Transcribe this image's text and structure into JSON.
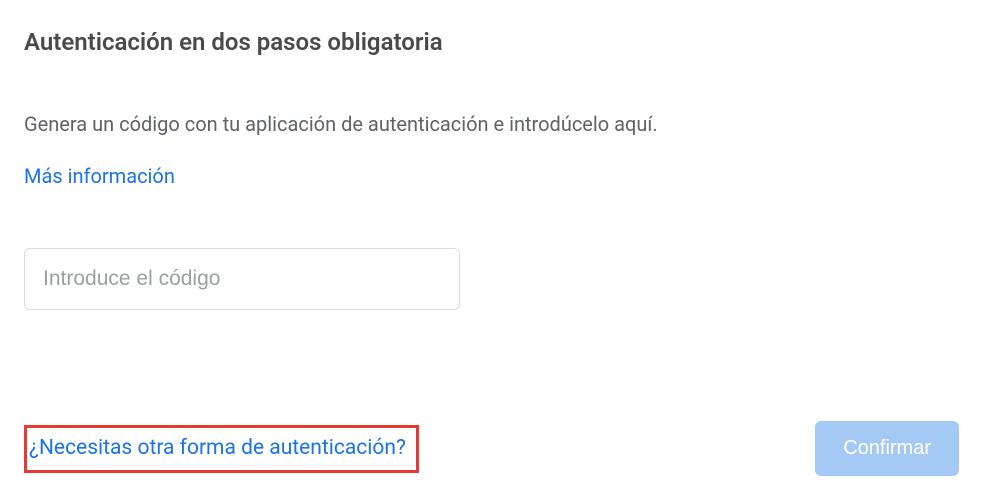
{
  "dialog": {
    "title": "Autenticación en dos pasos obligatoria",
    "description": "Genera un código con tu aplicación de autenticación e introdúcelo aquí.",
    "more_info_link": "Más información",
    "code_input_placeholder": "Introduce el código",
    "alt_auth_link": "¿Necesitas otra forma de autenticación?",
    "confirm_button": "Confirmar"
  }
}
